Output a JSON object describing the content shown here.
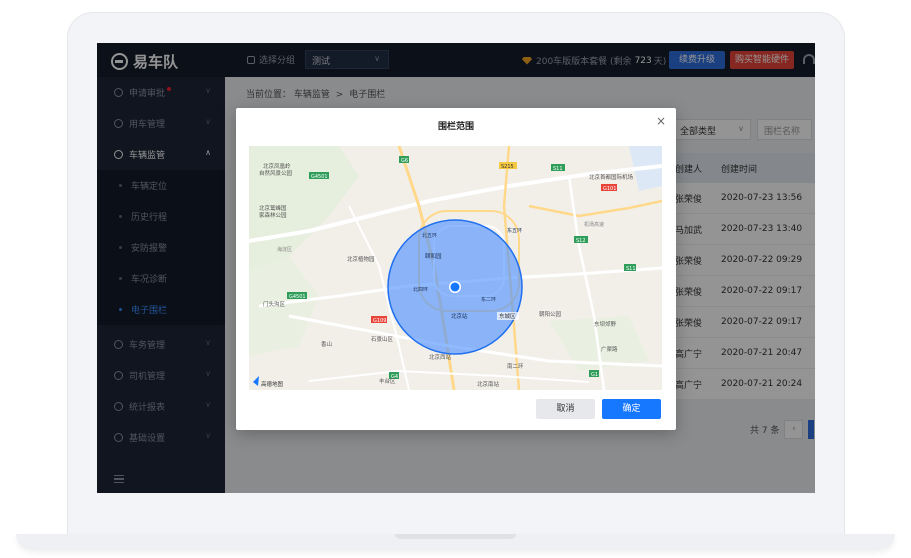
{
  "app": {
    "title": "易车队"
  },
  "topbar": {
    "group_label": "选择分组",
    "group_value": "测试",
    "package_text": "200车版版本套餐 (剩余",
    "package_remaining": "723",
    "package_suffix": "天)",
    "upgrade_label": "续费升级",
    "buy_label": "购买智能硬件"
  },
  "sidebar": {
    "items": [
      {
        "label": "申请审批"
      },
      {
        "label": "用车管理"
      },
      {
        "label": "车辆监管"
      },
      {
        "label": "车务管理"
      },
      {
        "label": "司机管理"
      },
      {
        "label": "统计报表"
      },
      {
        "label": "基础设置"
      }
    ],
    "sub_items": [
      {
        "label": "车辆定位"
      },
      {
        "label": "历史行程"
      },
      {
        "label": "安防报警"
      },
      {
        "label": "车况诊断"
      },
      {
        "label": "电子围栏"
      }
    ]
  },
  "breadcrumb": {
    "prefix": "当前位置：",
    "level1": "车辆监管",
    "sep": ">",
    "level2": "电子围栏"
  },
  "filters": {
    "type_value": "全部类型",
    "name_placeholder": "围栏名称"
  },
  "table": {
    "headers": {
      "creator": "创建人",
      "time": "创建时间"
    },
    "rows": [
      {
        "creator": "张荣俊",
        "time": "2020-07-23 13:56"
      },
      {
        "creator": "马加武",
        "time": "2020-07-23 13:40"
      },
      {
        "creator": "张荣俊",
        "time": "2020-07-22 09:29"
      },
      {
        "creator": "张荣俊",
        "time": "2020-07-22 09:17"
      },
      {
        "creator": "张荣俊",
        "time": "2020-07-22 09:17"
      },
      {
        "creator": "高广宁",
        "time": "2020-07-21 20:47"
      },
      {
        "creator": "高广宁",
        "time": "2020-07-21 20:24"
      }
    ]
  },
  "pagination": {
    "total": "共 7 条"
  },
  "modal": {
    "title": "围栏范围",
    "close": "×",
    "cancel_label": "取消",
    "ok_label": "确定"
  },
  "map": {
    "labels": {
      "l1": "北京凤凰岭",
      "l1b": "自然风景公园",
      "l2": "北京鹫峰国",
      "l2b": "家森林公园",
      "l3": "北京植物园",
      "l4": "颐和园",
      "l5": "北京首都国际机场",
      "l6": "北京站",
      "l7": "北京西站",
      "l8": "朝阳公园",
      "l9": "东坝郊野",
      "l10": "石景山区",
      "l11": "香山",
      "l12": "广渠路",
      "l13": "北京南站",
      "l14": "东城区",
      "l15": "海淀区",
      "l16": "西城区",
      "l17": "高德地图",
      "l18": "南二环",
      "l19": "北五环",
      "l20": "东五环",
      "l21": "丰台区",
      "l22": "门头沟区",
      "l23": "北四环",
      "l24": "东二环",
      "l25": "机场高速"
    },
    "roads": {
      "r1": "G4501",
      "r2": "G6",
      "r3": "S215",
      "r4": "S11",
      "r5": "G101",
      "r6": "S12",
      "r7": "G109",
      "r8": "G4",
      "r9": "S50",
      "r10": "G1"
    },
    "colors": {
      "fence_fill": "#4a90ff",
      "fence_stroke": "#1f6ff0",
      "center": "#1677ff"
    }
  }
}
